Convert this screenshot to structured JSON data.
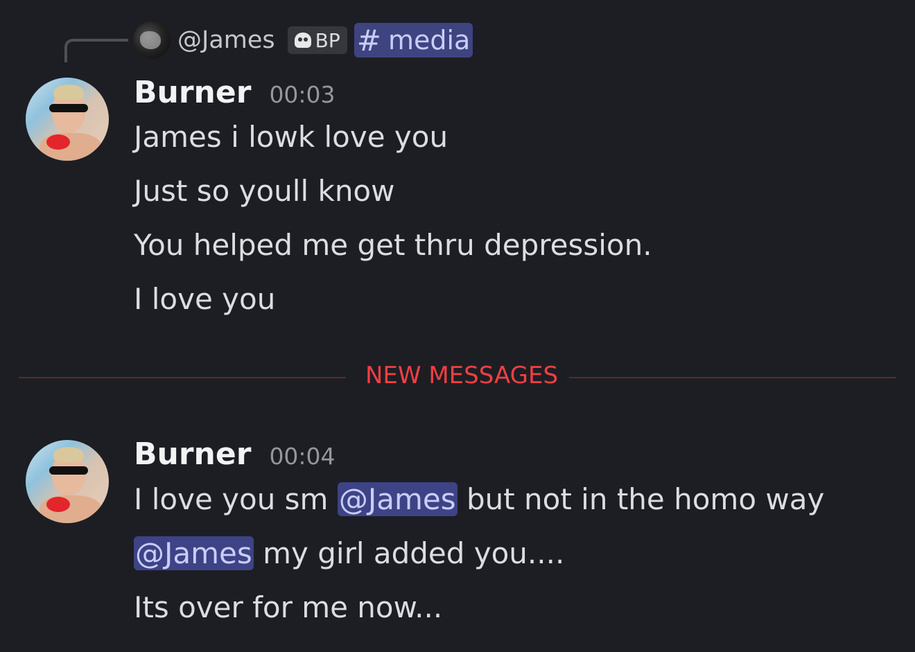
{
  "reply": {
    "username": "@James",
    "tag": "BP",
    "channel": "media"
  },
  "messages": [
    {
      "author": "Burner",
      "time": "00:03",
      "lines": [
        "James i lowk love you",
        "Just so youll know",
        "You helped me get thru depression.",
        "I love you"
      ]
    },
    {
      "author": "Burner",
      "time": "00:04",
      "line1": {
        "before": "I love you sm ",
        "mention": "@James",
        "after": " but not in the homo way"
      },
      "line2": {
        "mention": "@James",
        "after": " my girl added you...."
      },
      "line3": "Its over for me now..."
    }
  ],
  "divider": {
    "label": "NEW MESSAGES",
    "color": "#f23f43"
  },
  "colors": {
    "background": "#1d1e23",
    "mention_bg": "#3d4385",
    "mention_text": "#c9cdfb"
  }
}
